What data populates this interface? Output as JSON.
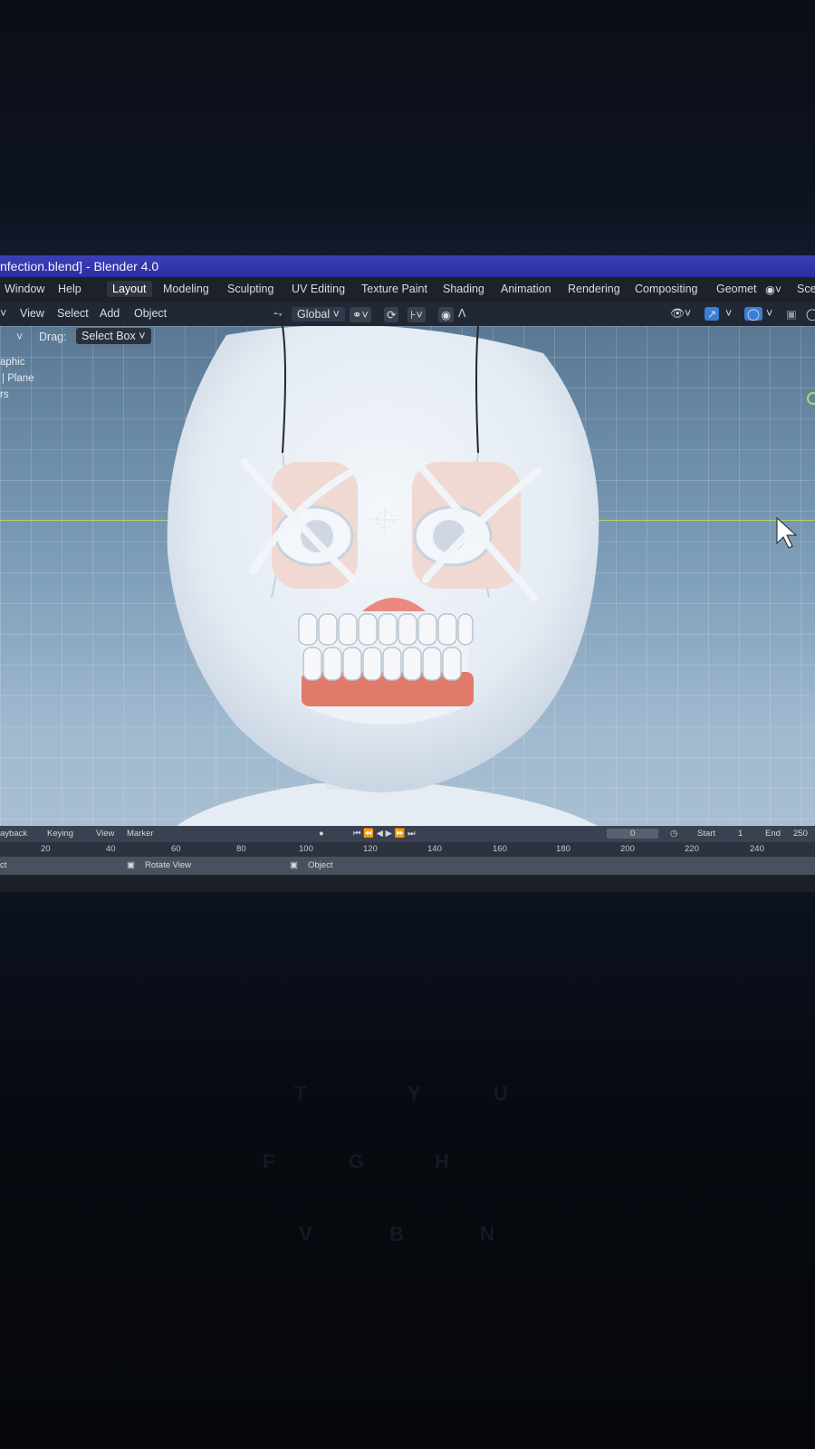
{
  "window": {
    "title": "nfection.blend] - Blender 4.0"
  },
  "menu": {
    "items": [
      "Window",
      "Help"
    ],
    "workspaces": [
      "Layout",
      "Modeling",
      "Sculpting",
      "UV Editing",
      "Texture Paint",
      "Shading",
      "Animation",
      "Rendering",
      "Compositing",
      "Geomet"
    ],
    "scene_label": "Sce"
  },
  "header": {
    "items": [
      "View",
      "Select",
      "Add",
      "Object"
    ],
    "transform_orientation": "Global"
  },
  "tool_settings": {
    "drag_label": "Drag:",
    "drag_value": "Select Box"
  },
  "outliner": {
    "rows": [
      "aphic",
      "Plane",
      "rs"
    ]
  },
  "timeline": {
    "playback": "ayback",
    "keying": "Keying",
    "view": "View",
    "marker": "Marker",
    "current_frame": "0",
    "start_label": "Start",
    "start_value": "1",
    "end_label": "End",
    "end_value": "250",
    "ruler_ticks": [
      "20",
      "40",
      "60",
      "80",
      "100",
      "120",
      "140",
      "160",
      "180",
      "200",
      "220",
      "240"
    ]
  },
  "statusbar": {
    "left": "ct",
    "rotate_view": "Rotate View",
    "object": "Object"
  },
  "colors": {
    "titlebar": "#2f33a8",
    "viewport_bg": "#7b9bb6",
    "horizon_line": "#b9d66b",
    "model": "#e8eef5",
    "gum": "#e07a6a"
  },
  "icons": [
    "cursor-pointer-icon",
    "3d-cursor-icon",
    "transform-orientation-icon",
    "snap-icon",
    "proportional-edit-icon",
    "visibility-icon",
    "gizmo-icon",
    "overlay-icon",
    "playback-controls-icon"
  ]
}
